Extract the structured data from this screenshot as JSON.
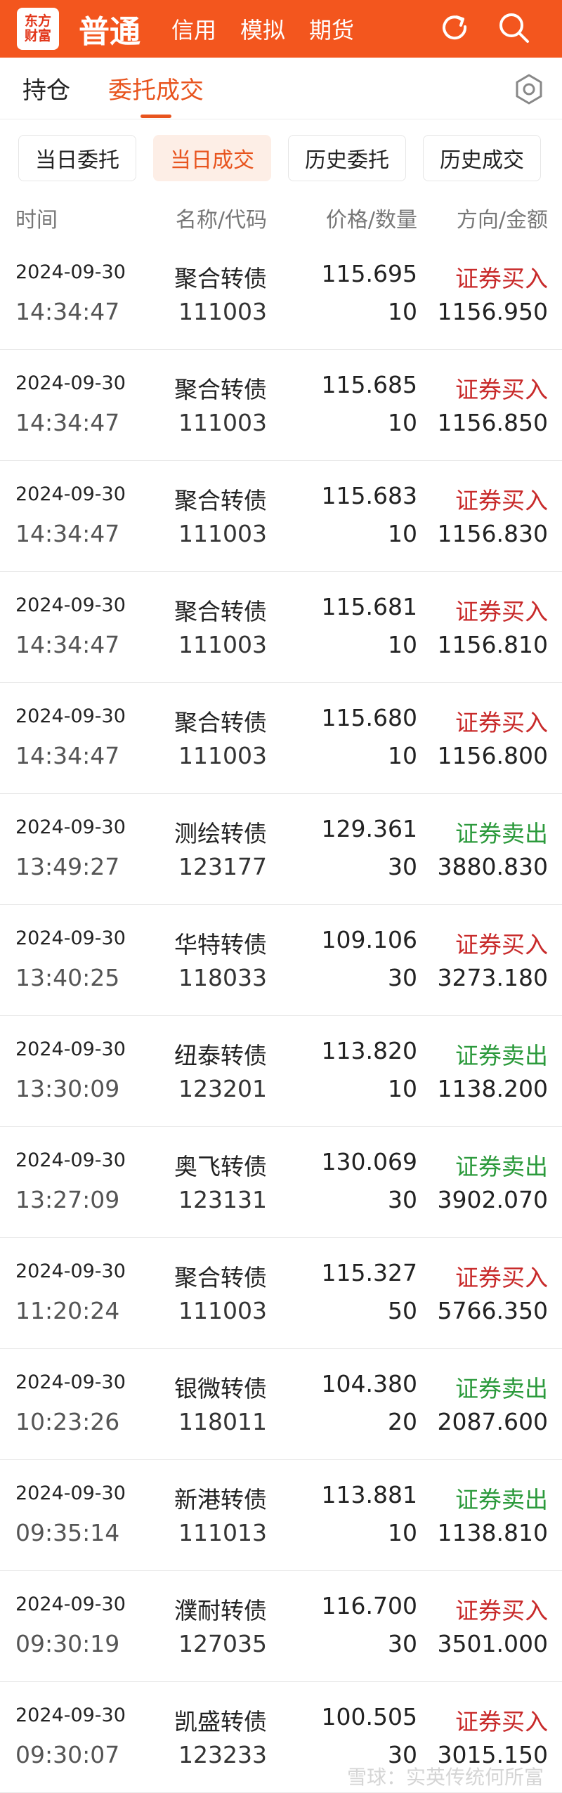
{
  "header": {
    "logo_line1": "东方",
    "logo_line2": "财富",
    "tabs": [
      "普通",
      "信用",
      "模拟",
      "期货"
    ],
    "refresh_icon": "refresh-icon",
    "search_icon": "search-icon",
    "bg_color": "#f3561e"
  },
  "subtabs": {
    "items": [
      "持仓",
      "委托成交"
    ],
    "active_index": 1,
    "settings_icon": "gear-icon",
    "accent": "#e8541e"
  },
  "filters": {
    "items": [
      "当日委托",
      "当日成交",
      "历史委托",
      "历史成交"
    ],
    "active_index": 1
  },
  "columns": {
    "time": "时间",
    "name_code": "名称/代码",
    "price_qty": "价格/数量",
    "dir_amount": "方向/金额"
  },
  "colors": {
    "buy": "#c82a2a",
    "sell": "#2c9a3c"
  },
  "rows": [
    {
      "date": "2024-09-30",
      "time": "14:34:47",
      "name": "聚合转债",
      "code": "111003",
      "price": "115.695",
      "qty": "10",
      "dir": "证券买入",
      "type": "buy",
      "amount": "1156.950"
    },
    {
      "date": "2024-09-30",
      "time": "14:34:47",
      "name": "聚合转债",
      "code": "111003",
      "price": "115.685",
      "qty": "10",
      "dir": "证券买入",
      "type": "buy",
      "amount": "1156.850"
    },
    {
      "date": "2024-09-30",
      "time": "14:34:47",
      "name": "聚合转债",
      "code": "111003",
      "price": "115.683",
      "qty": "10",
      "dir": "证券买入",
      "type": "buy",
      "amount": "1156.830"
    },
    {
      "date": "2024-09-30",
      "time": "14:34:47",
      "name": "聚合转债",
      "code": "111003",
      "price": "115.681",
      "qty": "10",
      "dir": "证券买入",
      "type": "buy",
      "amount": "1156.810"
    },
    {
      "date": "2024-09-30",
      "time": "14:34:47",
      "name": "聚合转债",
      "code": "111003",
      "price": "115.680",
      "qty": "10",
      "dir": "证券买入",
      "type": "buy",
      "amount": "1156.800"
    },
    {
      "date": "2024-09-30",
      "time": "13:49:27",
      "name": "测绘转债",
      "code": "123177",
      "price": "129.361",
      "qty": "30",
      "dir": "证券卖出",
      "type": "sell",
      "amount": "3880.830"
    },
    {
      "date": "2024-09-30",
      "time": "13:40:25",
      "name": "华特转债",
      "code": "118033",
      "price": "109.106",
      "qty": "30",
      "dir": "证券买入",
      "type": "buy",
      "amount": "3273.180"
    },
    {
      "date": "2024-09-30",
      "time": "13:30:09",
      "name": "纽泰转债",
      "code": "123201",
      "price": "113.820",
      "qty": "10",
      "dir": "证券卖出",
      "type": "sell",
      "amount": "1138.200"
    },
    {
      "date": "2024-09-30",
      "time": "13:27:09",
      "name": "奥飞转债",
      "code": "123131",
      "price": "130.069",
      "qty": "30",
      "dir": "证券卖出",
      "type": "sell",
      "amount": "3902.070"
    },
    {
      "date": "2024-09-30",
      "time": "11:20:24",
      "name": "聚合转债",
      "code": "111003",
      "price": "115.327",
      "qty": "50",
      "dir": "证券买入",
      "type": "buy",
      "amount": "5766.350"
    },
    {
      "date": "2024-09-30",
      "time": "10:23:26",
      "name": "银微转债",
      "code": "118011",
      "price": "104.380",
      "qty": "20",
      "dir": "证券卖出",
      "type": "sell",
      "amount": "2087.600"
    },
    {
      "date": "2024-09-30",
      "time": "09:35:14",
      "name": "新港转债",
      "code": "111013",
      "price": "113.881",
      "qty": "10",
      "dir": "证券卖出",
      "type": "sell",
      "amount": "1138.810"
    },
    {
      "date": "2024-09-30",
      "time": "09:30:19",
      "name": "濮耐转债",
      "code": "127035",
      "price": "116.700",
      "qty": "30",
      "dir": "证券买入",
      "type": "buy",
      "amount": "3501.000"
    },
    {
      "date": "2024-09-30",
      "time": "09:30:07",
      "name": "凯盛转债",
      "code": "123233",
      "price": "100.505",
      "qty": "30",
      "dir": "证券买入",
      "type": "buy",
      "amount": "3015.150"
    }
  ],
  "watermark": "雪球：实英传统何所富"
}
